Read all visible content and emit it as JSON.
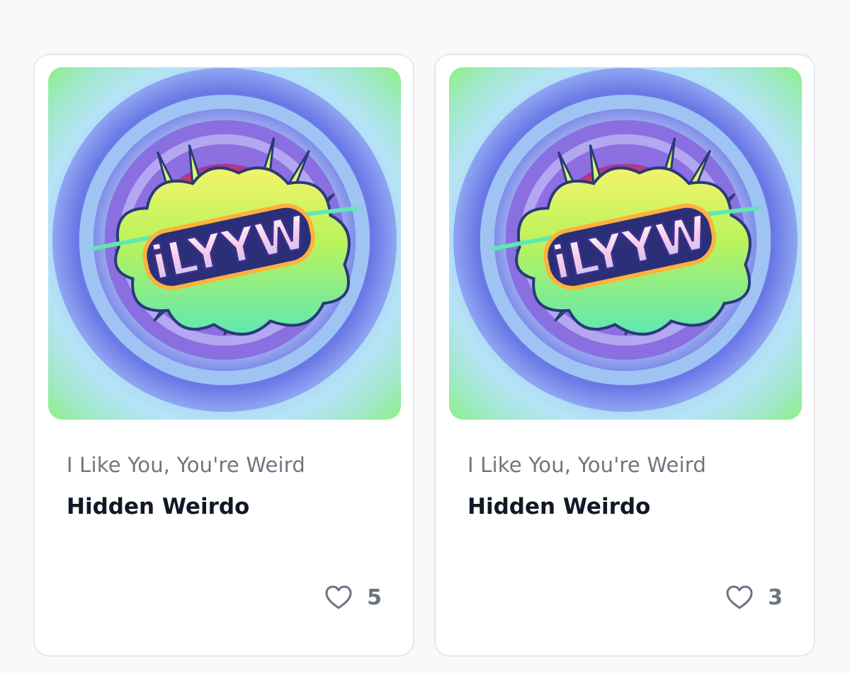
{
  "cards": [
    {
      "collection": "I Like You, You're Weird",
      "name": "Hidden Weirdo",
      "likes": "5",
      "image": {
        "logo_text": "iLYYW",
        "icon": "nft-artwork-image"
      }
    },
    {
      "collection": "I Like You, You're Weird",
      "name": "Hidden Weirdo",
      "likes": "3",
      "image": {
        "logo_text": "iLYYW",
        "icon": "nft-artwork-image"
      }
    }
  ],
  "icons": {
    "like": "heart-outline-icon"
  },
  "colors": {
    "page_background": "#f8f9fb",
    "card_border": "#e4e7ec",
    "collection_text": "#6f7682",
    "name_text": "#111827",
    "likes_text": "#6b7280"
  }
}
